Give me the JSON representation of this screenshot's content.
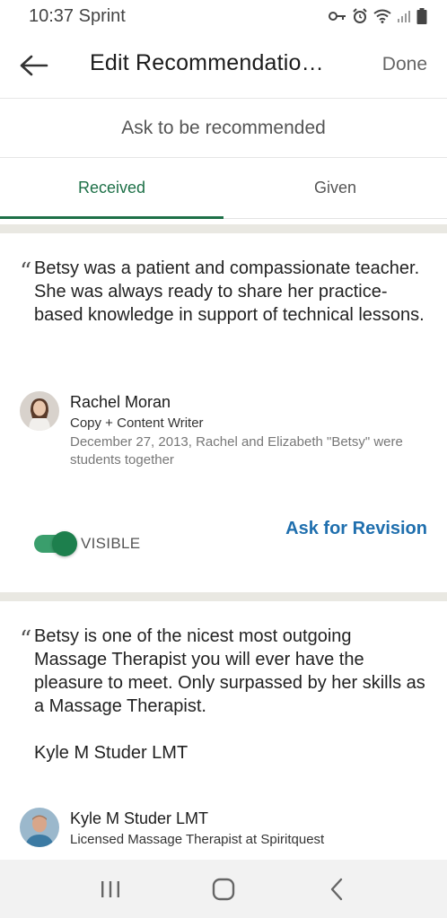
{
  "status_bar": {
    "time": "10:37 Sprint",
    "icons": [
      "key-icon",
      "alarm-icon",
      "wifi-icon",
      "signal-icon",
      "battery-icon"
    ]
  },
  "app_bar": {
    "title": "Edit Recommendatio…",
    "done_label": "Done"
  },
  "ask_bar": {
    "label": "Ask to be recommended"
  },
  "tabs": [
    {
      "label": "Received",
      "active": true
    },
    {
      "label": "Given",
      "active": false
    }
  ],
  "recommendations": [
    {
      "quote_mark": "“",
      "text": "Betsy was a patient and compassionate teacher. She was always ready to share her practice-based knowledge in support of technical lessons.",
      "name": "Rachel Moran",
      "role": "Copy + Content Writer",
      "date": "December 27, 2013, Rachel and Elizabeth \"Betsy\" were students together",
      "visibility_label": "VISIBLE",
      "visible": true,
      "revision_label": "Ask for Revision"
    },
    {
      "quote_mark": "“",
      "text": "Betsy is one of the nicest most outgoing Massage Therapist you will ever have the pleasure to meet.  Only surpassed by her skills as a Massage Therapist.\n\nKyle M Studer LMT",
      "name": "Kyle M Studer LMT",
      "role": "Licensed Massage Therapist at Spiritquest"
    }
  ],
  "colors": {
    "accent_green": "#1d7047",
    "link_blue": "#1f6fae",
    "divider": "#e9e8e2"
  },
  "nav_bar": {
    "buttons": [
      "recent-apps-icon",
      "home-icon",
      "back-icon"
    ]
  }
}
